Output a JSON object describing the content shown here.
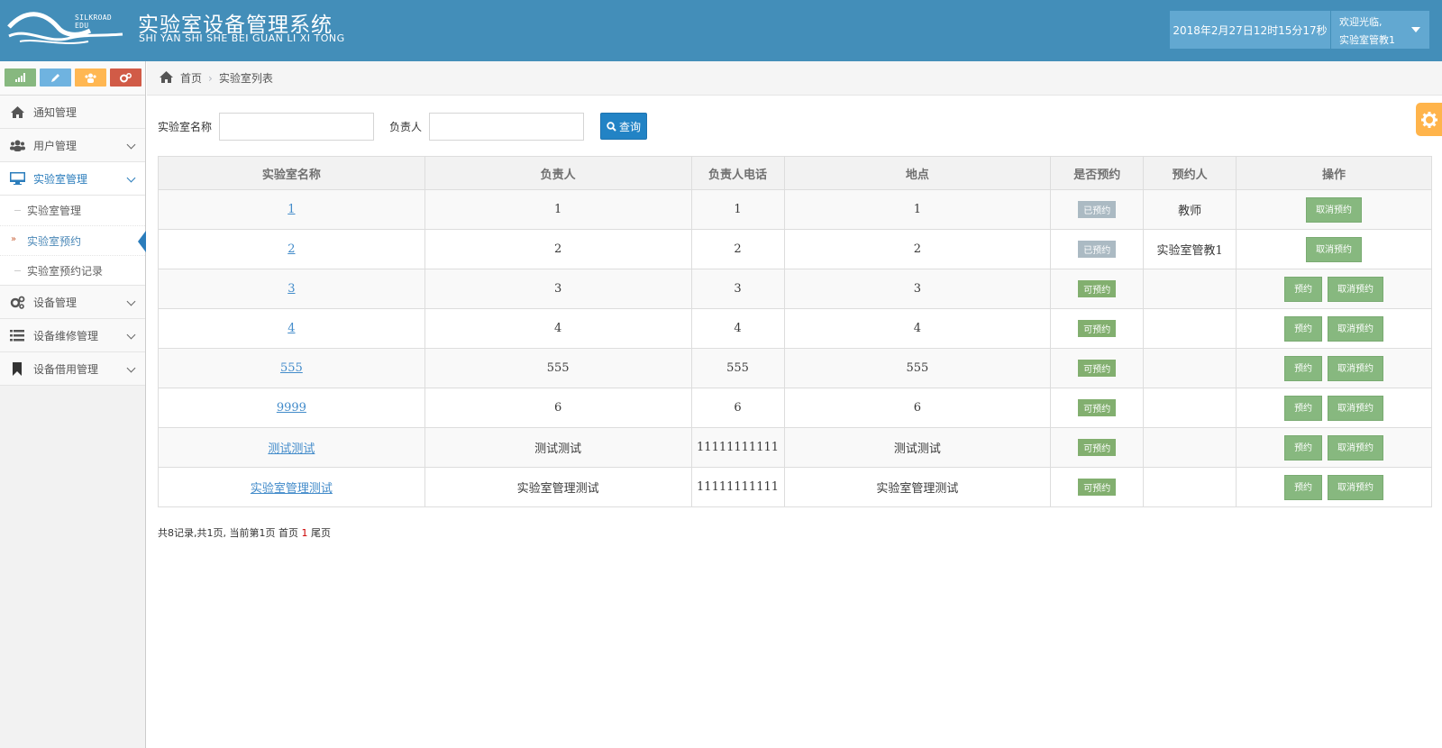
{
  "header": {
    "logo_text": "SILKROAD EDU",
    "title_cn": "实验室设备管理系统",
    "title_en": "SHI YAN SHI SHE BEI GUAN LI XI TONG",
    "datetime": "2018年2月27日12时15分17秒",
    "welcome": "欢迎光临,",
    "username": "实验室管教1"
  },
  "sidebar": {
    "shortcut_colors": [
      "#87b87f",
      "#6fb3e0",
      "#ffb752",
      "#d15b47"
    ],
    "items": [
      {
        "label": "通知管理",
        "icon": "home-icon"
      },
      {
        "label": "用户管理",
        "icon": "users-icon"
      },
      {
        "label": "实验室管理",
        "icon": "desktop-icon"
      },
      {
        "label": "设备管理",
        "icon": "cogs-icon"
      },
      {
        "label": "设备维修管理",
        "icon": "list-icon"
      },
      {
        "label": "设备借用管理",
        "icon": "bookmark-icon"
      }
    ],
    "lab_sub": [
      {
        "label": "实验室管理"
      },
      {
        "label": "实验室预约"
      },
      {
        "label": "实验室预约记录"
      }
    ]
  },
  "breadcrumb": {
    "home": "首页",
    "current": "实验室列表"
  },
  "search": {
    "lab_name_label": "实验室名称",
    "lab_name_value": "",
    "owner_label": "负责人",
    "owner_value": "",
    "query_button": "查询"
  },
  "table": {
    "headers": [
      "实验室名称",
      "负责人",
      "负责人电话",
      "地点",
      "是否预约",
      "预约人",
      "操作"
    ],
    "rows": [
      {
        "name": "1",
        "owner": "1",
        "phone": "1",
        "location": "1",
        "status": "已预约",
        "booker": "教师"
      },
      {
        "name": "2",
        "owner": "2",
        "phone": "2",
        "location": "2",
        "status": "已预约",
        "booker": "实验室管教1"
      },
      {
        "name": "3",
        "owner": "3",
        "phone": "3",
        "location": "3",
        "status": "可预约",
        "booker": ""
      },
      {
        "name": "4",
        "owner": "4",
        "phone": "4",
        "location": "4",
        "status": "可预约",
        "booker": ""
      },
      {
        "name": "555",
        "owner": "555",
        "phone": "555",
        "location": "555",
        "status": "可预约",
        "booker": ""
      },
      {
        "name": "9999",
        "owner": "6",
        "phone": "6",
        "location": "6",
        "status": "可预约",
        "booker": ""
      },
      {
        "name": "测试测试",
        "owner": "测试测试",
        "phone": "11111111111",
        "location": "测试测试",
        "status": "可预约",
        "booker": ""
      },
      {
        "name": "实验室管理测试",
        "owner": "实验室管理测试",
        "phone": "11111111111",
        "location": "实验室管理测试",
        "status": "可预约",
        "booker": ""
      }
    ],
    "book_label": "预约",
    "cancel_label": "取消预约",
    "status_booked": "已预约"
  },
  "pager": {
    "summary": "共8记录,共1页, 当前第1页",
    "first": "首页",
    "current": "1",
    "last": "尾页"
  }
}
